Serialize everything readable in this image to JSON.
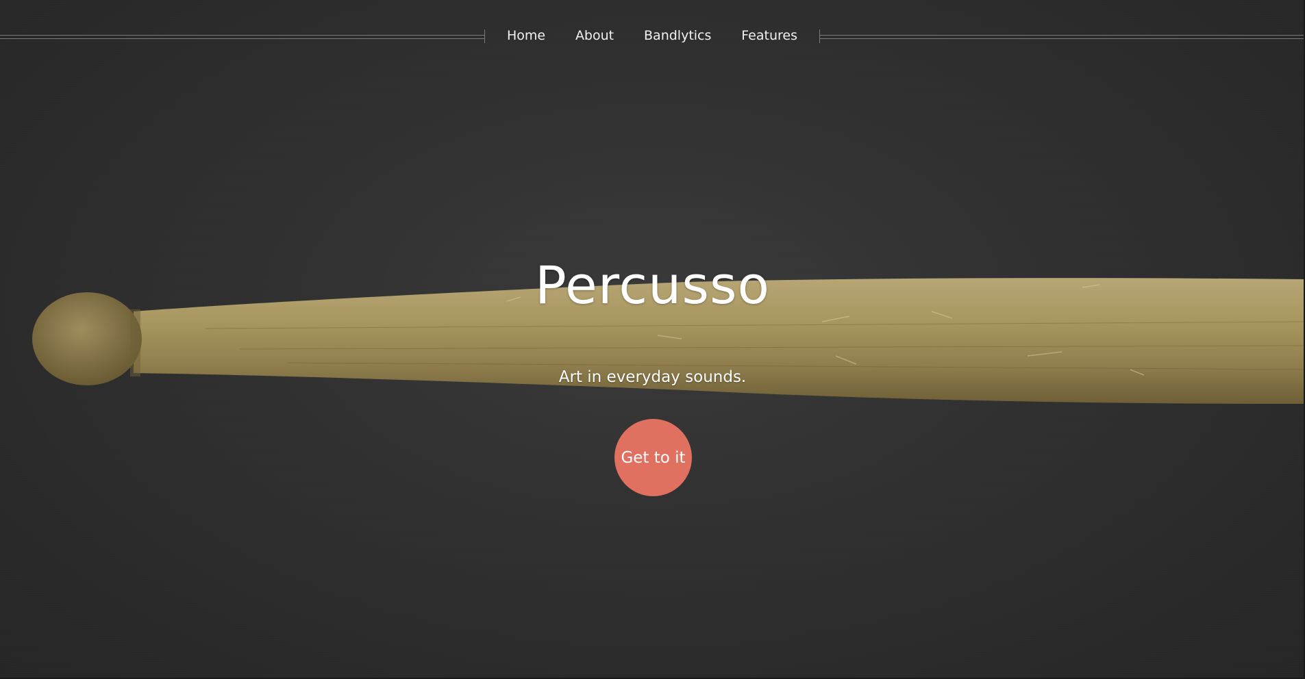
{
  "nav": {
    "items": [
      {
        "label": "Home"
      },
      {
        "label": "About"
      },
      {
        "label": "Bandlytics"
      },
      {
        "label": "Features"
      }
    ]
  },
  "hero": {
    "title": "Percusso",
    "subtitle": "Art in everyday sounds.",
    "cta_label": "Get to it"
  },
  "colors": {
    "background": "#2f2f2f",
    "cta": "#e07060",
    "text": "#ffffff",
    "drumstick": "#a8965f"
  },
  "icons": {
    "background_image": "drumstick-image"
  }
}
